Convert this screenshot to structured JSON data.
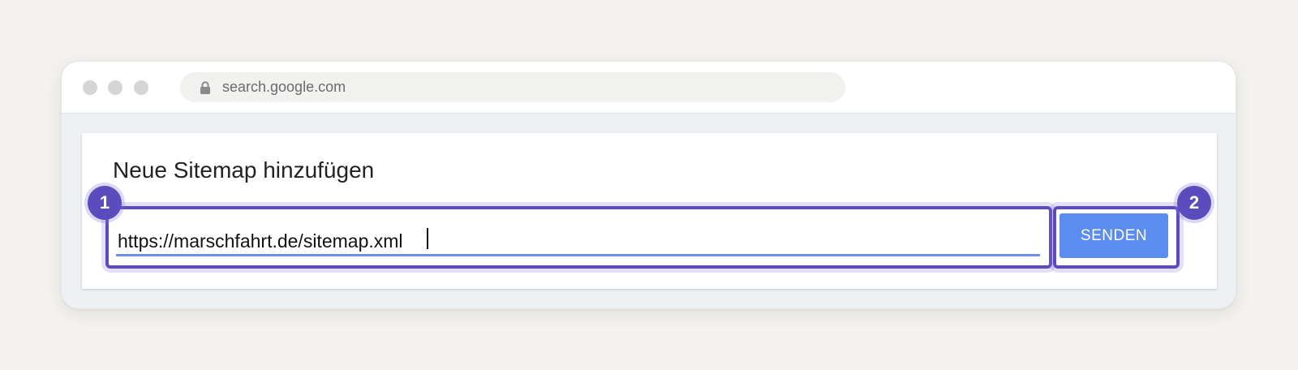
{
  "browser": {
    "url": "search.google.com"
  },
  "card": {
    "title": "Neue Sitemap hinzufügen",
    "input_value": "https://marschfahrt.de/sitemap.xml",
    "submit_label": "SENDEN"
  },
  "annotations": {
    "badges": [
      "1",
      "2"
    ],
    "accent_color": "#5b4cbd"
  },
  "colors": {
    "button": "#5b8def",
    "input_underline": "#6c8fe8"
  }
}
